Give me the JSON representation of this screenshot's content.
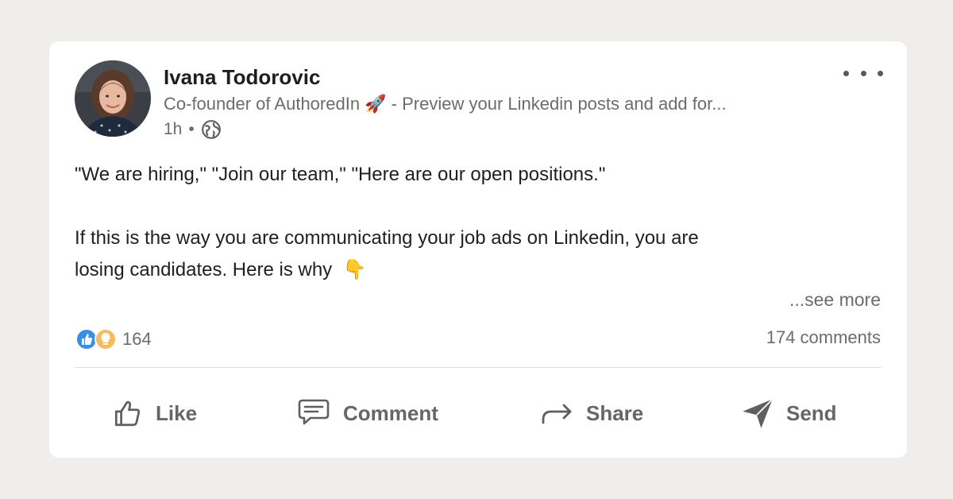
{
  "post": {
    "author": {
      "name": "Ivana Todorovic",
      "headline": "Co-founder of AuthoredIn 🚀 - Preview your Linkedin posts and add for...",
      "time": "1h",
      "separator": "•"
    },
    "body": {
      "paragraph1": "\"We are hiring,\" \"Join our team,\" \"Here are our open positions.\"",
      "paragraph2_line1": "If this is the way you are communicating your job ads on Linkedin, you are",
      "paragraph2_line2": "losing candidates. Here is why",
      "pointing_emoji": "👇"
    },
    "see_more": "...see more",
    "reactions": {
      "count": "164",
      "types": [
        "like-icon",
        "insightful-icon"
      ],
      "colors": {
        "like": "#378fe9",
        "insightful": "#f5bb5c"
      }
    },
    "comments": "174 comments",
    "actions": {
      "like": "Like",
      "comment": "Comment",
      "share": "Share",
      "send": "Send"
    }
  },
  "theme": {
    "background": "#efeeec",
    "card": "#ffffff",
    "muted_text": "#6c6c6c",
    "action_text": "#666666"
  }
}
